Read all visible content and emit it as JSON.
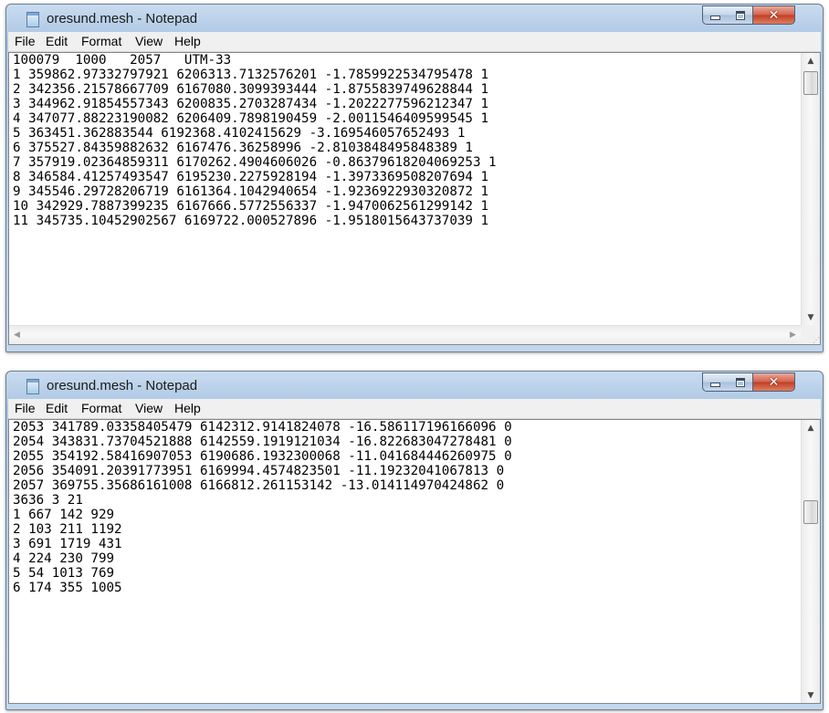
{
  "windows": [
    {
      "title": "oresund.mesh - Notepad",
      "menu": [
        "File",
        "Edit",
        "Format",
        "View",
        "Help"
      ],
      "controls": {
        "minimize_icon": "minimize-icon",
        "maximize_icon": "maximize-icon",
        "close_icon": "close-icon",
        "close_glyph": "✕"
      },
      "lines": [
        "100079  1000   2057   UTM-33",
        "1 359862.97332797921 6206313.7132576201 -1.7859922534795478 1",
        "2 342356.21578667709 6167080.3099393444 -1.8755839749628844 1",
        "3 344962.91854557343 6200835.2703287434 -1.2022277596212347 1",
        "4 347077.88223190082 6206409.7898190459 -2.0011546409599545 1",
        "5 363451.362883544 6192368.4102415629 -3.169546057652493 1",
        "6 375527.84359882632 6167476.36258996 -2.8103848495848389 1",
        "7 357919.02364859311 6170262.4904606026 -0.86379618204069253 1",
        "8 346584.41257493547 6195230.2275928194 -1.3973369508207694 1",
        "9 345546.29728206719 6161364.1042940654 -1.9236922930320872 1",
        "10 342929.7887399235 6167666.5772556337 -1.9470062561299142 1",
        "11 345735.10452902567 6169722.000527896 -1.9518015643737039 1"
      ],
      "scroll": {
        "up": "▲",
        "down": "▼",
        "left": "◀",
        "right": "▶",
        "grip": "⋰"
      }
    },
    {
      "title": "oresund.mesh - Notepad",
      "menu": [
        "File",
        "Edit",
        "Format",
        "View",
        "Help"
      ],
      "controls": {
        "minimize_icon": "minimize-icon",
        "maximize_icon": "maximize-icon",
        "close_icon": "close-icon",
        "close_glyph": "✕"
      },
      "lines": [
        "2053 341789.03358405479 6142312.9141824078 -16.586117196166096 0",
        "2054 343831.73704521888 6142559.1919121034 -16.822683047278481 0",
        "2055 354192.58416907053 6190686.1932300068 -11.041684446260975 0",
        "2056 354091.20391773951 6169994.4574823501 -11.19232041067813 0",
        "2057 369755.35686161008 6166812.261153142 -13.014114970424862 0",
        "3636 3 21",
        "1 667 142 929",
        "2 103 211 1192",
        "3 691 1719 431",
        "4 224 230 799",
        "5 54 1013 769",
        "6 174 355 1005"
      ],
      "scroll": {
        "up": "▲",
        "down": "▼"
      }
    }
  ]
}
